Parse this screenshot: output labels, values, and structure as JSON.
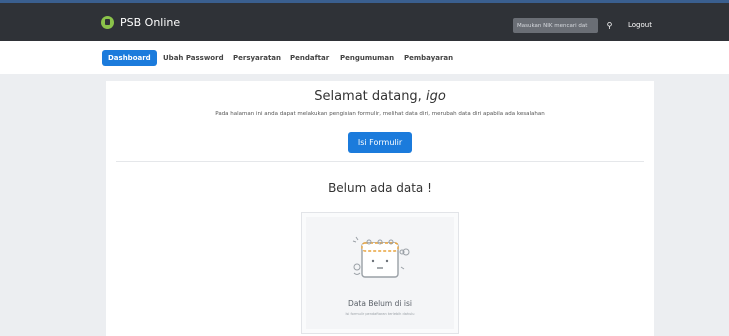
{
  "header": {
    "brand": "PSB Online",
    "search_placeholder": "Masukan NIK mencari dat",
    "logout_label": "Logout"
  },
  "nav": {
    "items": [
      {
        "label": "Dashboard",
        "active": true
      },
      {
        "label": "Ubah Password",
        "active": false
      },
      {
        "label": "Persyaratan",
        "active": false
      },
      {
        "label": "Pendaftar",
        "active": false
      },
      {
        "label": "Pengumuman",
        "active": false
      },
      {
        "label": "Pembayaran",
        "active": false
      }
    ]
  },
  "main": {
    "welcome_prefix": "Selamat datang, ",
    "welcome_user": "igo",
    "description": "Pada halaman ini anda dapat melakukan pengisian formulir, melihat data diri, merubah data diri apabila ada kesalahan",
    "cta_label": "Isi Formulir",
    "empty_title": "Belum ada data !",
    "empty_caption": "Data Belum di isi",
    "empty_sub": "Isi formulir pendaftaran terlebih dahulu"
  },
  "colors": {
    "accent": "#1b7bdc",
    "topbar": "#2f3237",
    "brand_logo": "#8bc34a"
  }
}
